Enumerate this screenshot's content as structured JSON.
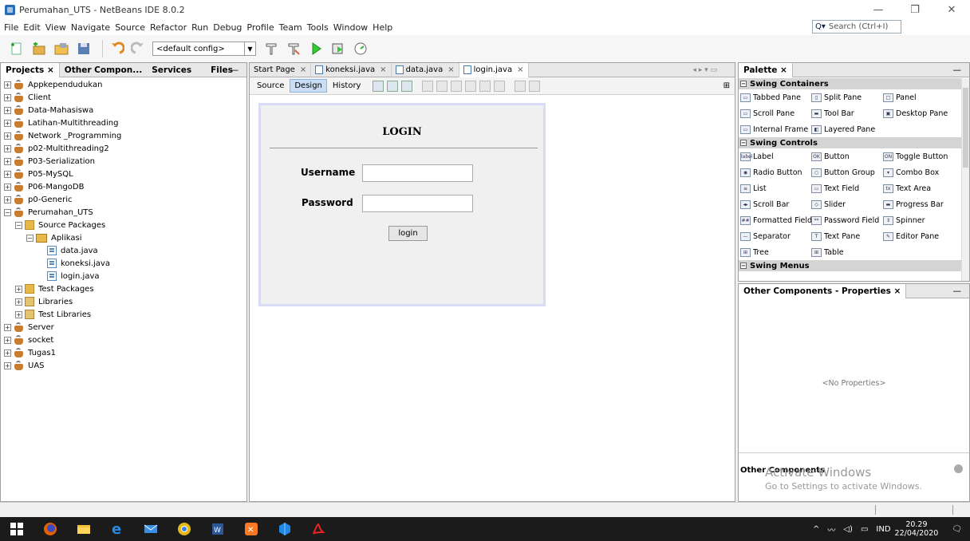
{
  "window": {
    "title": "Perumahan_UTS - NetBeans IDE 8.0.2",
    "controls": [
      "—",
      "❐",
      "✕"
    ]
  },
  "menu": [
    "File",
    "Edit",
    "View",
    "Navigate",
    "Source",
    "Refactor",
    "Run",
    "Debug",
    "Profile",
    "Team",
    "Tools",
    "Window",
    "Help"
  ],
  "search": {
    "placeholder": "Search (Ctrl+I)"
  },
  "toolbar": {
    "config": "<default config>"
  },
  "projects_panel": {
    "tabs": [
      "Projects",
      "Other Compon...",
      "Services",
      "Files"
    ],
    "close_glyph": "×",
    "minimize_glyph": "—",
    "items": [
      {
        "label": "Appkependudukan",
        "indent": 0,
        "type": "project",
        "exp": "+"
      },
      {
        "label": "Client",
        "indent": 0,
        "type": "project",
        "exp": "+"
      },
      {
        "label": "Data-Mahasiswa",
        "indent": 0,
        "type": "project",
        "exp": "+"
      },
      {
        "label": "Latihan-Multithreading",
        "indent": 0,
        "type": "project",
        "exp": "+"
      },
      {
        "label": "Network _Programming",
        "indent": 0,
        "type": "project",
        "exp": "+"
      },
      {
        "label": "p02-Multithreading2",
        "indent": 0,
        "type": "project",
        "exp": "+"
      },
      {
        "label": "P03-Serialization",
        "indent": 0,
        "type": "project",
        "exp": "+"
      },
      {
        "label": "P05-MySQL",
        "indent": 0,
        "type": "project",
        "exp": "+"
      },
      {
        "label": "P06-MangoDB",
        "indent": 0,
        "type": "project",
        "exp": "+"
      },
      {
        "label": "p0-Generic",
        "indent": 0,
        "type": "project",
        "exp": "+"
      },
      {
        "label": "Perumahan_UTS",
        "indent": 0,
        "type": "project",
        "exp": "−"
      },
      {
        "label": "Source Packages",
        "indent": 1,
        "type": "pkg",
        "exp": "−"
      },
      {
        "label": "Aplikasi",
        "indent": 2,
        "type": "pkgplain",
        "exp": "−"
      },
      {
        "label": "data.java",
        "indent": 3,
        "type": "java",
        "exp": ""
      },
      {
        "label": "koneksi.java",
        "indent": 3,
        "type": "java",
        "exp": ""
      },
      {
        "label": "login.java",
        "indent": 3,
        "type": "java",
        "exp": ""
      },
      {
        "label": "Test Packages",
        "indent": 1,
        "type": "pkg",
        "exp": "+"
      },
      {
        "label": "Libraries",
        "indent": 1,
        "type": "lib",
        "exp": "+"
      },
      {
        "label": "Test Libraries",
        "indent": 1,
        "type": "lib",
        "exp": "+"
      },
      {
        "label": "Server",
        "indent": 0,
        "type": "project",
        "exp": "+"
      },
      {
        "label": "socket",
        "indent": 0,
        "type": "project",
        "exp": "+"
      },
      {
        "label": "Tugas1",
        "indent": 0,
        "type": "project",
        "exp": "+"
      },
      {
        "label": "UAS",
        "indent": 0,
        "type": "project",
        "exp": "+"
      }
    ]
  },
  "editor": {
    "tabs": [
      "Start Page",
      "koneksi.java",
      "data.java",
      "login.java"
    ],
    "views": [
      "Source",
      "Design",
      "History"
    ],
    "form": {
      "title": "LOGIN",
      "username_label": "Username",
      "password_label": "Password",
      "button": "login"
    }
  },
  "palette": {
    "tab": "Palette",
    "sections": [
      {
        "name": "Swing Containers",
        "items": [
          {
            "label": "Tabbed Pane",
            "icon": "▭"
          },
          {
            "label": "Split Pane",
            "icon": "▯"
          },
          {
            "label": "Panel",
            "icon": "□"
          },
          {
            "label": "Scroll Pane",
            "icon": "▭"
          },
          {
            "label": "Tool Bar",
            "icon": "▬"
          },
          {
            "label": "Desktop Pane",
            "icon": "▣"
          },
          {
            "label": "Internal Frame",
            "icon": "▭"
          },
          {
            "label": "Layered Pane",
            "icon": "◧"
          }
        ]
      },
      {
        "name": "Swing Controls",
        "items": [
          {
            "label": "Label",
            "icon": "label"
          },
          {
            "label": "Button",
            "icon": "OK"
          },
          {
            "label": "Toggle Button",
            "icon": "ON"
          },
          {
            "label": "Radio Button",
            "icon": "◉"
          },
          {
            "label": "Button Group",
            "icon": "○"
          },
          {
            "label": "Combo Box",
            "icon": "▾"
          },
          {
            "label": "List",
            "icon": "≡"
          },
          {
            "label": "Text Field",
            "icon": "▭"
          },
          {
            "label": "Text Area",
            "icon": "tx"
          },
          {
            "label": "Scroll Bar",
            "icon": "◂▸"
          },
          {
            "label": "Slider",
            "icon": "◇"
          },
          {
            "label": "Progress Bar",
            "icon": "▬"
          },
          {
            "label": "Formatted Field",
            "icon": "##"
          },
          {
            "label": "Password Field",
            "icon": "**"
          },
          {
            "label": "Spinner",
            "icon": "⇕"
          },
          {
            "label": "Separator",
            "icon": "—"
          },
          {
            "label": "Text Pane",
            "icon": "T"
          },
          {
            "label": "Editor Pane",
            "icon": "✎"
          },
          {
            "label": "Tree",
            "icon": "⊞"
          },
          {
            "label": "Table",
            "icon": "⊞"
          }
        ]
      },
      {
        "name": "Swing Menus",
        "items": []
      }
    ]
  },
  "properties": {
    "tab": "Other Components - Properties",
    "empty": "<No Properties>",
    "other_components": "Other Components"
  },
  "watermark": {
    "line1": "Activate Windows",
    "line2": "Go to Settings to activate Windows."
  },
  "taskbar": {
    "lang": "IND",
    "time": "20.29",
    "date": "22/04/2020"
  }
}
